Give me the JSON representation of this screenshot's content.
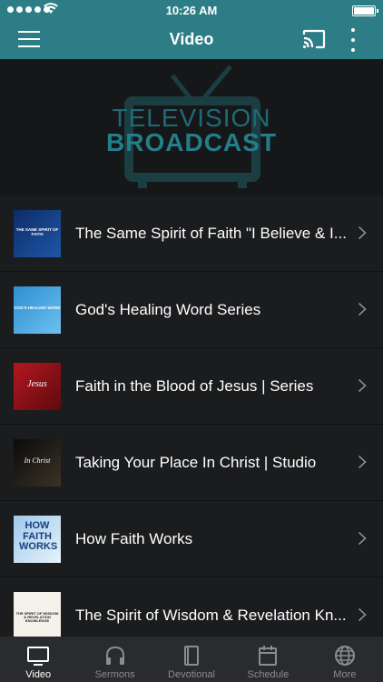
{
  "status_bar": {
    "time": "10:26 AM"
  },
  "nav": {
    "title": "Video"
  },
  "banner": {
    "line1": "TELEVISION",
    "line2": "BROADCAST"
  },
  "videos": [
    {
      "label": "The Same Spirit of Faith \"I Believe & I...",
      "thumb_text": "THE SAME SPIRIT OF FAITH"
    },
    {
      "label": "God's Healing Word Series",
      "thumb_text": "GOD'S HEALING WORD"
    },
    {
      "label": "Faith in the Blood of Jesus | Series",
      "thumb_text": "Jesus"
    },
    {
      "label": "Taking Your Place In Christ | Studio",
      "thumb_text": "In Christ"
    },
    {
      "label": "How Faith Works",
      "thumb_text": "HOW FAITH WORKS"
    },
    {
      "label": "The Spirit of Wisdom & Revelation Kn...",
      "thumb_text": "THE SPIRIT OF WISDOM & REVELATION KNOWLEDGE"
    }
  ],
  "tabs": [
    {
      "label": "Video",
      "icon": "tv-icon",
      "active": true
    },
    {
      "label": "Sermons",
      "icon": "headphones-icon",
      "active": false
    },
    {
      "label": "Devotional",
      "icon": "book-icon",
      "active": false
    },
    {
      "label": "Schedule",
      "icon": "calendar-icon",
      "active": false
    },
    {
      "label": "More",
      "icon": "globe-icon",
      "active": false
    }
  ],
  "colors": {
    "accent": "#2c7d86",
    "background": "#1b1c1e",
    "tab_bar": "#2a2b2e"
  }
}
